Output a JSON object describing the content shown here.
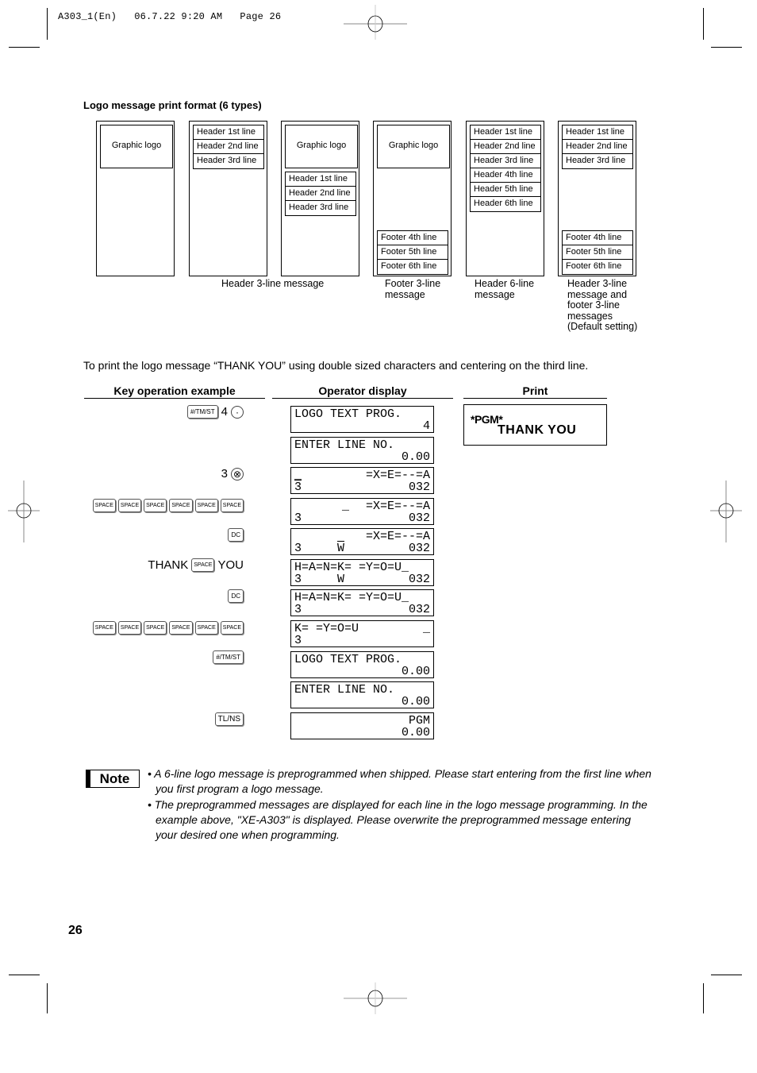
{
  "file_header": "A303_1(En)   06.7.22 9:20 AM   Page 26",
  "section_title": "Logo message print format (6 types)",
  "formats": [
    {
      "type": "graphic-only",
      "logo": "Graphic logo",
      "header_lines": [],
      "footer_lines": []
    },
    {
      "type": "header-3",
      "logo": null,
      "header_lines": [
        "Header 1st line",
        "Header 2nd line",
        "Header 3rd line"
      ],
      "footer_lines": []
    },
    {
      "type": "graphic-header-3",
      "logo": "Graphic logo",
      "header_lines": [
        "Header 1st line",
        "Header 2nd line",
        "Header 3rd line"
      ],
      "footer_lines": []
    },
    {
      "type": "graphic-footer-3",
      "logo": "Graphic logo",
      "header_lines": [],
      "footer_lines": [
        "Footer 4th line",
        "Footer 5th line",
        "Footer 6th line"
      ]
    },
    {
      "type": "header-6",
      "logo": null,
      "header_lines": [
        "Header 1st line",
        "Header 2nd line",
        "Header 3rd line",
        "Header 4th line",
        "Header 5th line",
        "Header 6th line"
      ],
      "footer_lines": []
    },
    {
      "type": "header-3-footer-3",
      "logo": null,
      "header_lines": [
        "Header 1st line",
        "Header 2nd line",
        "Header 3rd line"
      ],
      "footer_lines": [
        "Footer 4th line",
        "Footer 5th line",
        "Footer 6th line"
      ]
    }
  ],
  "captions": {
    "header3": "Header 3-line message",
    "footer3": [
      "Footer 3-line",
      "message"
    ],
    "header6": [
      "Header 6-line",
      "message"
    ],
    "default": [
      "Header 3-line",
      "message and",
      "footer 3-line",
      "messages",
      "(Default setting)"
    ]
  },
  "intro": "To print the logo message “THANK YOU” using double sized characters and centering on the third line.",
  "columns": {
    "key_ops": "Key operation example",
    "operator_display": "Operator display",
    "print": "Print"
  },
  "keys": {
    "tmst": "#/TM/ST",
    "space": "SPACE",
    "dc": "DC",
    "tlns": "TL/NS",
    "dot": "·",
    "mult": "⊗"
  },
  "key_steps": {
    "s1_num": "4",
    "s3_num": "3",
    "s6_word1": "THANK",
    "s6_word2": "YOU"
  },
  "displays": [
    {
      "l1": "LOGO TEXT PROG.",
      "l2": "4"
    },
    {
      "l1": "ENTER LINE NO.",
      "l2": "0.00"
    },
    {
      "l1_cursor": "_",
      "l1": "=X=E=--=A",
      "l2_left": "3",
      "l2_right": "032"
    },
    {
      "l1_cursor": "_",
      "l1": "=X=E=--=A",
      "l2_left": "3",
      "l2_right": "032"
    },
    {
      "l1": "=X=E=--=A",
      "l2_left": "3",
      "l2_mid": "W",
      "l2_right": "032"
    },
    {
      "l1": "H=A=N=K= =Y=O=U_",
      "l2_left": "3",
      "l2_mid": "W",
      "l2_right": "032"
    },
    {
      "l1": "H=A=N=K= =Y=O=U_",
      "l2_left": "3",
      "l2_right": "032"
    },
    {
      "l1": "K= =Y=O=U",
      "l1_cursor": "_",
      "l2_left": "3"
    },
    {
      "l1": "LOGO TEXT PROG.",
      "l2": "0.00"
    },
    {
      "l1": "ENTER LINE NO.",
      "l2": "0.00"
    },
    {
      "l1": "PGM",
      "l2": "0.00"
    }
  ],
  "print": {
    "line1": "*PGM*",
    "line2": "THANK YOU"
  },
  "note": {
    "label": "Note",
    "items": [
      "• A 6-line logo message is preprogrammed when shipped.  Please start entering from the first line when you first program a logo message.",
      "• The preprogrammed messages are displayed for each line in the logo message programming. In the example above, \"XE-A303\" is displayed. Please overwrite the preprogrammed message entering your desired one when programming."
    ]
  },
  "page_number": "26"
}
